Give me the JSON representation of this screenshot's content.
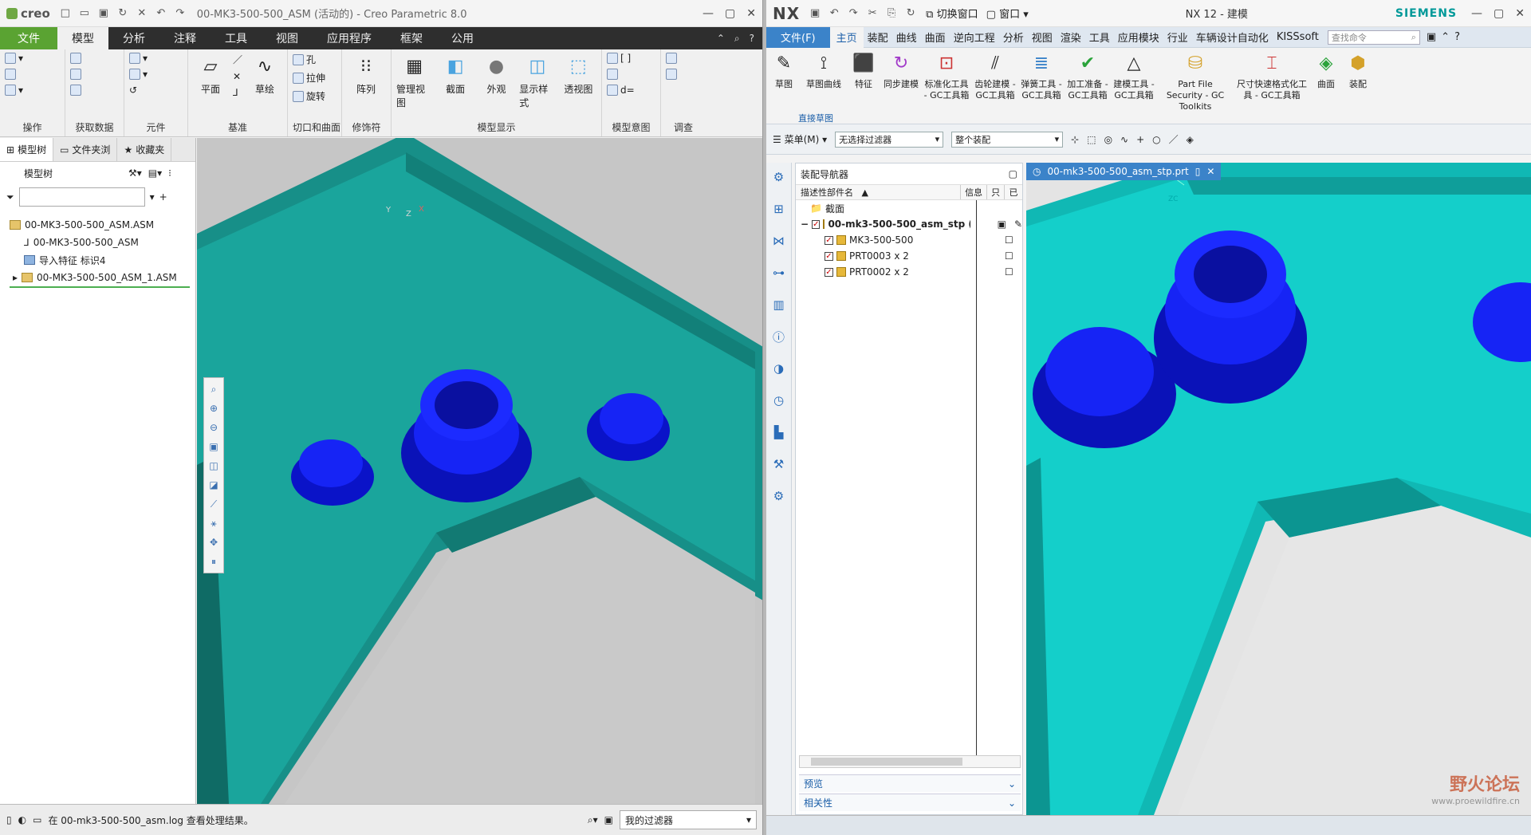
{
  "creo": {
    "brand": "creo",
    "title": "00-MK3-500-500_ASM (活动的) - Creo Parametric 8.0",
    "menu": {
      "file": "文件",
      "tabs": [
        "模型",
        "分析",
        "注释",
        "工具",
        "视图",
        "应用程序",
        "框架",
        "公用"
      ]
    },
    "ribbon": {
      "groups": {
        "ops": "操作",
        "getdata": "获取数据",
        "component": "元件",
        "datum": "基准",
        "cut": "切口和曲面",
        "modifiers": "修饰符",
        "display": "模型显示",
        "intent": "模型意图",
        "investigate": "调查"
      },
      "buttons": {
        "plane": "平面",
        "sketch": "草绘",
        "hole": "孔",
        "extrude": "拉伸",
        "revolve": "旋转",
        "pattern": "阵列",
        "manage_views": "管理视图",
        "section": "截面",
        "appearance": "外观",
        "display_style": "显示样式",
        "perspective": "透视图"
      }
    },
    "panel_tabs": [
      "模型树",
      "文件夹浏",
      "收藏夹"
    ],
    "tree_header": "模型树",
    "tree": [
      {
        "label": "00-MK3-500-500_ASM.ASM",
        "indent": 0
      },
      {
        "label": "00-MK3-500-500_ASM",
        "indent": 1
      },
      {
        "label": "导入特征 标识4",
        "indent": 1
      },
      {
        "label": "00-MK3-500-500_ASM_1.ASM",
        "indent": 1
      }
    ],
    "status_message": "在 00-mk3-500-500_asm.log 查看处理结果。",
    "filter": "我的过滤器"
  },
  "nx": {
    "brand": "NX",
    "title": "NX 12 - 建模",
    "vendor": "SIEMENS",
    "quick": {
      "switch_window": "切换窗口",
      "window": "窗口"
    },
    "menu": {
      "file": "文件(F)",
      "tabs": [
        "主页",
        "装配",
        "曲线",
        "曲面",
        "逆向工程",
        "分析",
        "视图",
        "渲染",
        "工具",
        "应用模块",
        "行业",
        "车辆设计自动化",
        "KISSsoft"
      ],
      "command_search": "查找命令"
    },
    "ribbon": [
      {
        "label": "草图"
      },
      {
        "label": "草图曲线"
      },
      {
        "label": "特征"
      },
      {
        "label": "同步建模"
      },
      {
        "label": "标准化工具 - GC工具箱"
      },
      {
        "label": "齿轮建模 - GC工具箱"
      },
      {
        "label": "弹簧工具 - GC工具箱"
      },
      {
        "label": "加工准备 - GC工具箱"
      },
      {
        "label": "建模工具 - GC工具箱"
      },
      {
        "label": "Part File Security - GC Toolkits"
      },
      {
        "label": "尺寸快速格式化工具 - GC工具箱"
      },
      {
        "label": "曲面"
      },
      {
        "label": "装配"
      }
    ],
    "direct_sketch": "直接草图",
    "toolbar": {
      "menu": "菜单(M)",
      "filter": "无选择过滤器",
      "scope": "整个装配"
    },
    "navigator": {
      "title": "装配导航器",
      "columns": {
        "name": "描述性部件名",
        "info": "信息",
        "read_only": "只",
        "modified": "已"
      },
      "rows": [
        {
          "label": "截面",
          "type": "folder"
        },
        {
          "label": "00-mk3-500-500_asm_stp  (...",
          "type": "assembly"
        },
        {
          "label": "MK3-500-500",
          "type": "part"
        },
        {
          "label": "PRT0003 x 2",
          "type": "part"
        },
        {
          "label": "PRT0002 x 2",
          "type": "part"
        }
      ],
      "preview": "预览",
      "dependencies": "相关性"
    },
    "viewport_tab": "00-mk3-500-500_asm_stp.prt",
    "watermark": {
      "title": "野火论坛",
      "url": "www.proewildfire.cn"
    }
  },
  "colors": {
    "teal": "#14a79e",
    "blue": "#0b16f0",
    "creo_green": "#5aa332",
    "nx_blue": "#3b83c9"
  }
}
